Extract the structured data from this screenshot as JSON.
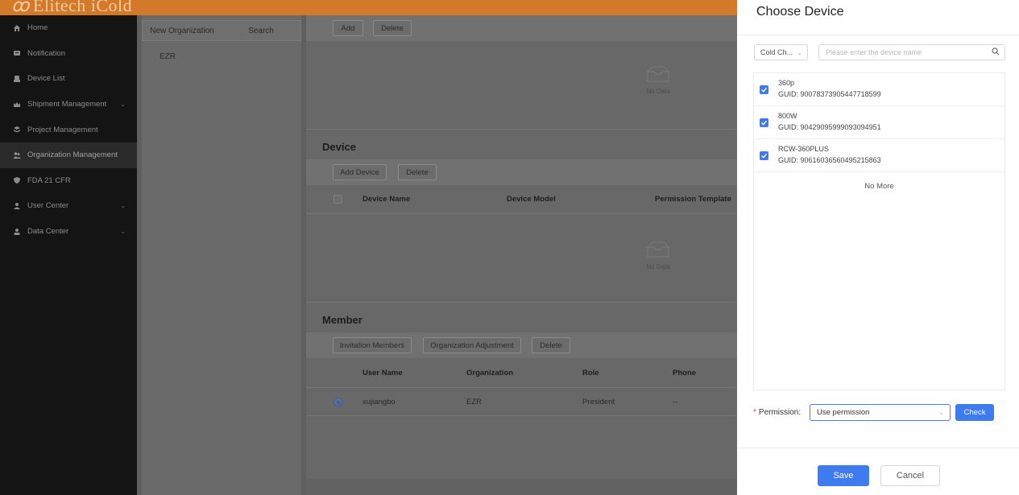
{
  "app": {
    "logo_text": "Elitech iCold"
  },
  "sidebar": {
    "items": [
      {
        "label": "Home",
        "icon": "home-icon"
      },
      {
        "label": "Notification",
        "icon": "notification-icon"
      },
      {
        "label": "Device List",
        "icon": "device-list-icon"
      },
      {
        "label": "Shipment Management",
        "icon": "shipment-icon"
      },
      {
        "label": "Project Management",
        "icon": "project-icon"
      },
      {
        "label": "Organization Management",
        "icon": "organization-icon",
        "active": true
      },
      {
        "label": "FDA 21 CFR",
        "icon": "shield-icon"
      },
      {
        "label": "User Center",
        "icon": "user-icon"
      },
      {
        "label": "Data Center",
        "icon": "data-center-icon"
      }
    ]
  },
  "org_panel": {
    "new_org_label": "New Organization",
    "search_label": "Search",
    "tree": [
      "EZR"
    ]
  },
  "main": {
    "top_toolbar": {
      "add_label": "Add",
      "delete_label": "Delete"
    },
    "no_data_text": "No Data",
    "device_section": {
      "title": "Device",
      "add_device_label": "Add Device",
      "delete_label": "Delete",
      "columns": [
        "Device Name",
        "Device Model",
        "Permission Template"
      ],
      "no_data_text": "No Data"
    },
    "member_section": {
      "title": "Member",
      "invitation_label": "Invitation Members",
      "adjustment_label": "Organization Adjustment",
      "delete_label": "Delete",
      "columns": [
        "User Name",
        "Organization",
        "Role",
        "Phone"
      ],
      "rows": [
        {
          "user": "xujiangbo",
          "organization": "EZR",
          "role": "President",
          "phone": "--"
        }
      ]
    }
  },
  "drawer": {
    "title": "Choose Device",
    "filter_select": "Cold Ch...",
    "search_placeholder": "Please enter the device name",
    "devices": [
      {
        "name": "360p",
        "guid": "GUID: 90078373905447718599"
      },
      {
        "name": "800W",
        "guid": "GUID: 90429095999093094951"
      },
      {
        "name": "RCW-360PLUS",
        "guid": "GUID: 90616036560495215863"
      }
    ],
    "no_more_text": "No More",
    "permission_label": "Permission:",
    "permission_value": "Use permission",
    "check_label": "Check",
    "save_label": "Save",
    "cancel_label": "Cancel"
  },
  "colors": {
    "accent": "#3e7af0",
    "topbar": "#d27a2a",
    "sidebar": "#141414"
  }
}
